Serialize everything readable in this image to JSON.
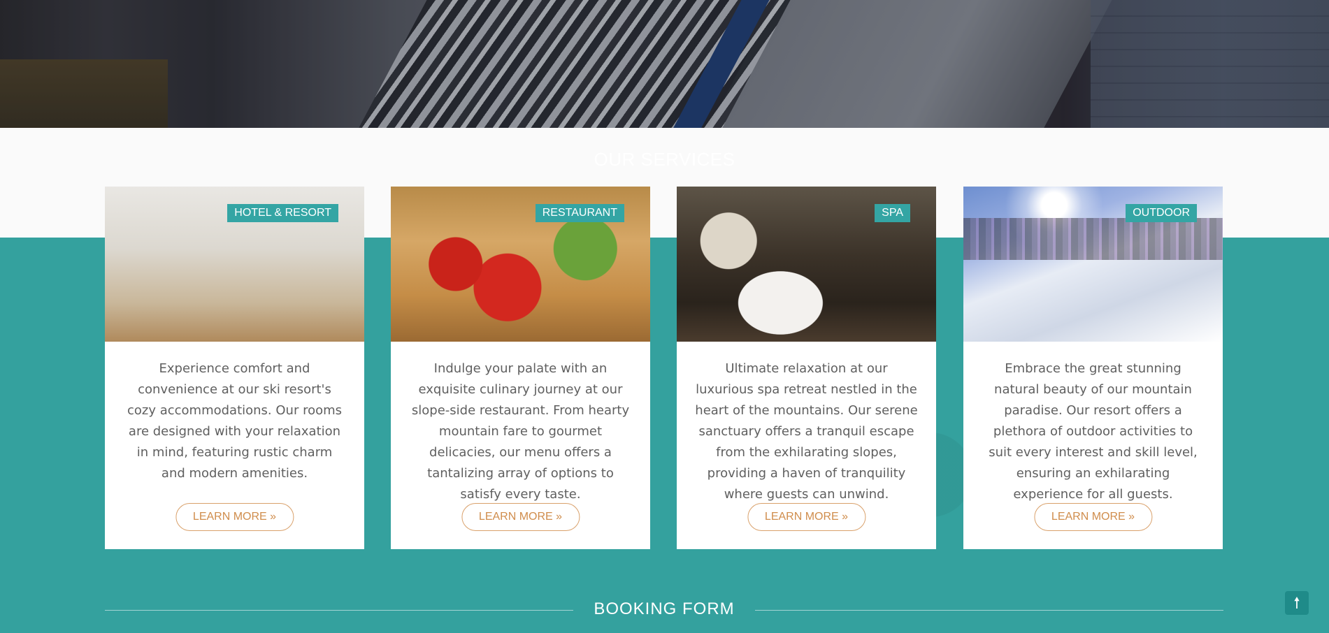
{
  "services": {
    "title": "OUR SERVICES",
    "cards": [
      {
        "tag": "HOTEL & RESORT",
        "description": "Experience comfort and convenience at our ski resort's cozy accommodations. Our rooms are designed with your relaxation in mind, featuring rustic charm and modern amenities.",
        "button": "LEARN MORE »"
      },
      {
        "tag": "RESTAURANT",
        "description": "Indulge your palate with an exquisite culinary journey at our slope-side restaurant. From hearty mountain fare to gourmet delicacies, our menu offers a tantalizing array of options to satisfy every taste.",
        "button": "LEARN MORE »"
      },
      {
        "tag": "SPA",
        "description": "Ultimate relaxation at our luxurious spa retreat nestled in the heart of the mountains. Our serene sanctuary offers a tranquil escape from the exhilarating slopes, providing a haven of tranquility where guests can unwind.",
        "button": "LEARN MORE »"
      },
      {
        "tag": "OUTDOOR",
        "description": "Embrace the great stunning natural beauty of our mountain paradise. Our resort offers a plethora of outdoor activities to suit every interest and skill level, ensuring an exhilarating experience for all guests.",
        "button": "LEARN MORE »"
      }
    ]
  },
  "booking": {
    "title": "BOOKING FORM"
  },
  "scroll_top": {
    "icon": "arrow-up-icon",
    "glyph": "🠕"
  },
  "colors": {
    "teal": "#34a19e",
    "tag_bg": "#34a5a4",
    "button_border": "#d9a06a",
    "button_text": "#d08d4c"
  }
}
